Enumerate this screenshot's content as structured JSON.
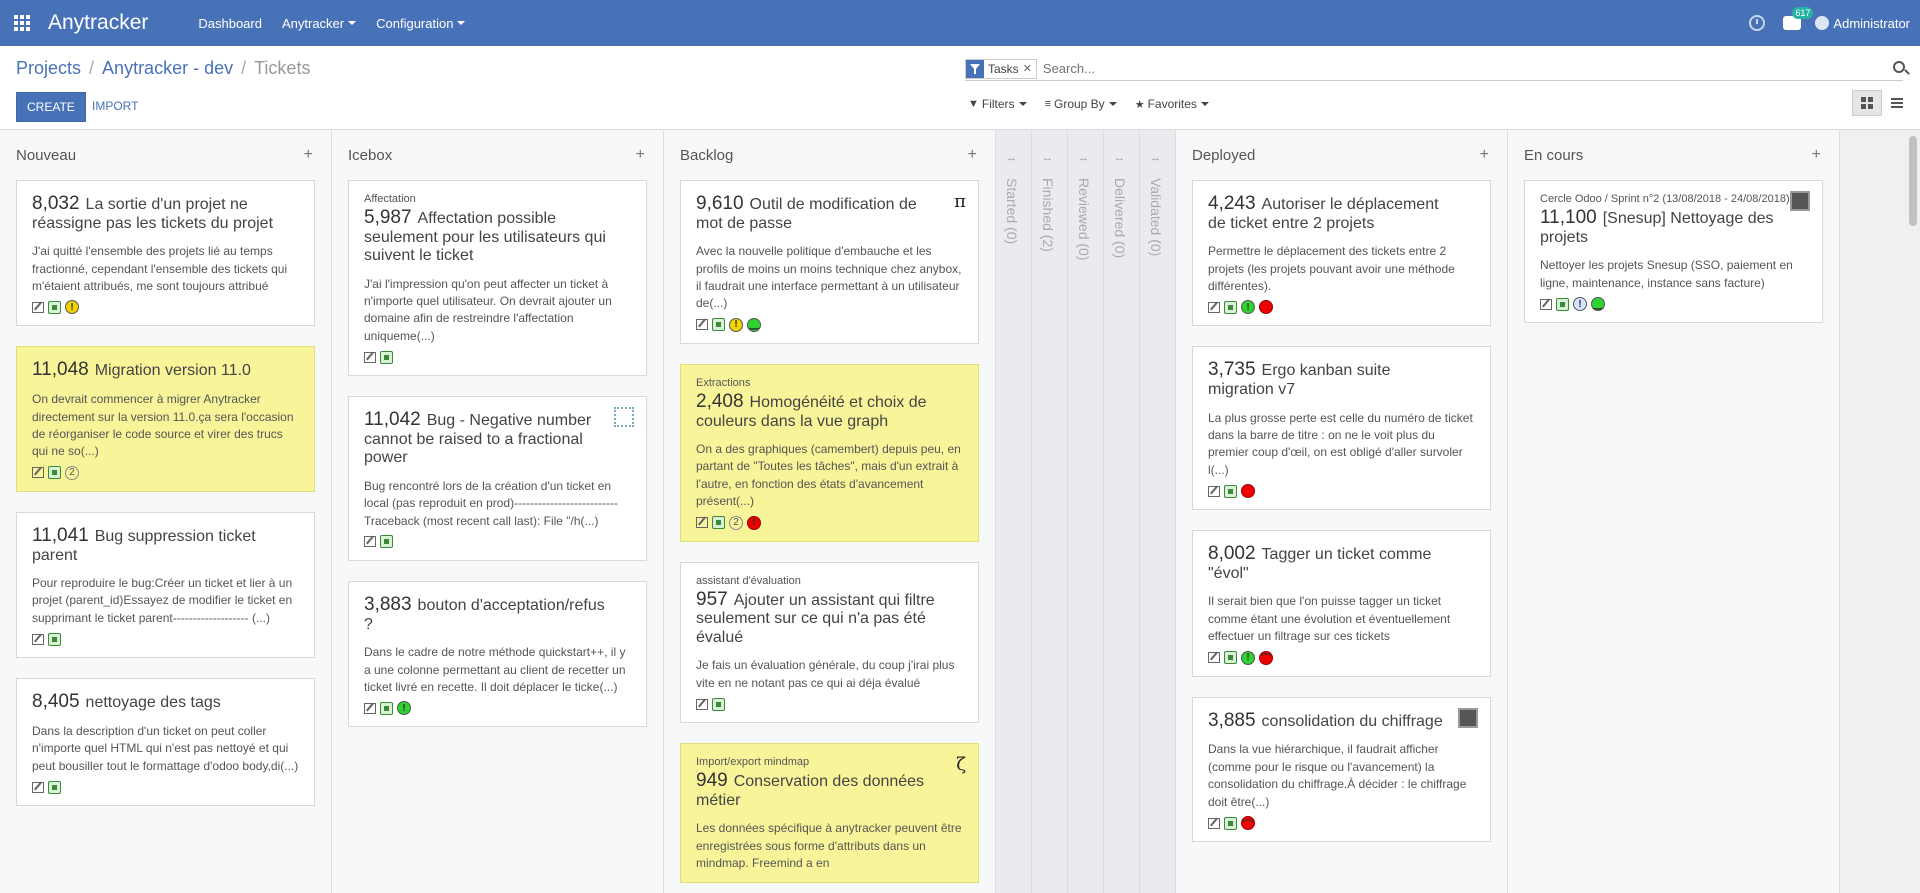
{
  "navbar": {
    "brand": "Anytracker",
    "menu": [
      "Dashboard",
      "Anytracker",
      "Configuration"
    ],
    "chat_count": "617",
    "user": "Administrator"
  },
  "breadcrumb": {
    "projects": "Projects",
    "project": "Anytracker - dev",
    "current": "Tickets"
  },
  "buttons": {
    "create": "CREATE",
    "import": "IMPORT"
  },
  "search": {
    "facet": "Tasks",
    "placeholder": "Search..."
  },
  "filters": {
    "filters": "Filters",
    "group_by": "Group By",
    "favorites": "Favorites"
  },
  "columns": {
    "nouveau": {
      "title": "Nouveau",
      "cards": [
        {
          "num": "8,032",
          "title": "La sortie d'un projet ne réassigne pas les tickets du projet",
          "desc": "J'ai quitté l'ensemble des projets lié au temps fractionné, cependant l'ensemble des tickets qui m'étaient attribués, me sont toujours attribué"
        },
        {
          "num": "11,048",
          "title": "Migration version 11.0",
          "desc": "On devrait commencer à migrer Anytracker directement sur la version 11.0.ça sera l'occasion de réorganiser le code source et virer des trucs qui ne so(...)",
          "count": "2"
        },
        {
          "num": "11,041",
          "title": "Bug suppression ticket parent",
          "desc": "Pour reproduire le bug:Créer un ticket et lier à un projet (parent_id)Essayez de modifier le ticket en supprimant le ticket parent------------------- (...)"
        },
        {
          "num": "8,405",
          "title": "nettoyage des tags",
          "desc": "Dans la description d'un ticket on peut coller n'importe quel HTML qui n'est pas nettoyé et qui peut bousiller tout le formattage d'odoo body,di(...)"
        }
      ]
    },
    "icebox": {
      "title": "Icebox",
      "cards": [
        {
          "tag": "Affectation",
          "num": "5,987",
          "title": "Affectation possible seulement pour les utilisateurs qui suivent le ticket",
          "desc": "J'ai l'impression qu'on peut affecter un ticket à n'importe quel utilisateur. On devrait ajouter un domaine afin de restreindre l'affectation uniqueme(...)"
        },
        {
          "num": "11,042",
          "title": "Bug - Negative number cannot be raised to a fractional power",
          "desc": "Bug rencontré lors de la création d'un ticket en local (pas reproduit en prod)--------------------------Traceback (most recent call last): File \"/h(...)"
        },
        {
          "num": "3,883",
          "title": "bouton d'acceptation/refus ?",
          "desc": "Dans le cadre de notre méthode quickstart++, il y a une colonne permettant au client de recetter un ticket livré en recette. Il doit déplacer le ticke(...)"
        }
      ]
    },
    "backlog": {
      "title": "Backlog",
      "cards": [
        {
          "num": "9,610",
          "title": "Outil de modification de mot de passe",
          "desc": "Avec la nouvelle politique d'embauche et les profils de moins un moins technique chez anybox, il faudrait une interface permettant à un utilisateur de(...)",
          "corner": "π"
        },
        {
          "tag": "Extractions",
          "num": "2,408",
          "title": "Homogénéité et choix de couleurs dans la vue graph",
          "desc": "On a des graphiques (camembert) depuis peu, en partant de \"Toutes les tâches\", mais d'un extrait à l'autre, en fonction des états d'avancement présent(...)",
          "count": "2"
        },
        {
          "tag": "assistant d'évaluation",
          "num": "957",
          "title": "Ajouter un assistant qui filtre seulement sur ce qui n'a pas été évalué",
          "desc": "Je fais un évaluation générale, du coup j'irai plus vite en ne notant pas ce qui ai déja évalué"
        },
        {
          "tag": "Import/export mindmap",
          "num": "949",
          "title": "Conservation des données métier",
          "desc": "Les données spécifique à anytracker peuvent être enregistrées sous forme d'attributs dans un mindmap. Freemind a en",
          "corner": "ζ"
        }
      ]
    },
    "folded": [
      "Started (0)",
      "Finished (2)",
      "Reviewed (0)",
      "Delivered (0)",
      "Validated (0)"
    ],
    "deployed": {
      "title": "Deployed",
      "cards": [
        {
          "num": "4,243",
          "title": "Autoriser le déplacement de ticket entre 2 projets",
          "desc": "Permettre le déplacement des tickets entre 2 projets (les projets pouvant avoir une méthode différentes)."
        },
        {
          "num": "3,735",
          "title": "Ergo kanban suite migration v7",
          "desc": "La plus grosse perte est celle du numéro de ticket dans la barre de titre : on ne le voit plus du premier coup d'œil, on est obligé d'aller survoler l(...)"
        },
        {
          "num": "8,002",
          "title": "Tagger un ticket comme \"évol\"",
          "desc": "Il serait bien que l'on puisse tagger un ticket comme étant une évolution et éventuellement effectuer un filtrage sur ces tickets"
        },
        {
          "num": "3,885",
          "title": "consolidation du chiffrage",
          "desc": "Dans la vue hiérarchique, il faudrait afficher (comme pour le risque ou l'avancement) la consolidation du chiffrage.À décider : le chiffrage doit être(...)"
        }
      ]
    },
    "en_cours": {
      "title": "En cours",
      "cards": [
        {
          "tag": "Cercle Odoo / Sprint n°2 (13/08/2018 - 24/08/2018)",
          "num": "11,100",
          "title": "[Snesup] Nettoyage des projets",
          "desc": "Nettoyer les projets Snesup (SSO, paiement en ligne, maintenance, instance sans facture)"
        }
      ]
    }
  }
}
